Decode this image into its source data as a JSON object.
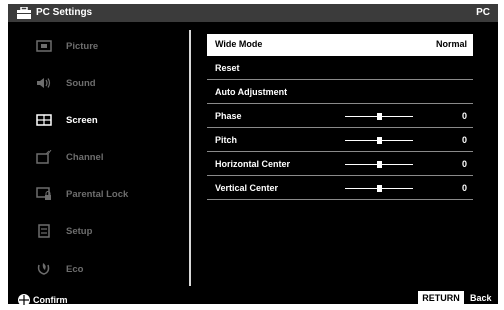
{
  "window": {
    "title": "PC Settings",
    "input_label": "PC"
  },
  "sidebar": {
    "items": [
      {
        "label": "Picture",
        "icon": "picture-icon",
        "active": false
      },
      {
        "label": "Sound",
        "icon": "speaker-icon",
        "active": false
      },
      {
        "label": "Screen",
        "icon": "screen-icon",
        "active": true
      },
      {
        "label": "Channel",
        "icon": "channel-icon",
        "active": false
      },
      {
        "label": "Parental Lock",
        "icon": "parental-lock-icon",
        "active": false
      },
      {
        "label": "Setup",
        "icon": "setup-icon",
        "active": false
      },
      {
        "label": "Eco",
        "icon": "eco-icon",
        "active": false
      }
    ]
  },
  "menu": {
    "rows": [
      {
        "label": "Wide Mode",
        "value": "Normal",
        "selected": true
      },
      {
        "label": "Reset"
      },
      {
        "label": "Auto Adjustment"
      },
      {
        "label": "Phase",
        "value": "0",
        "slider_level": 0.5
      },
      {
        "label": "Pitch",
        "value": "0",
        "slider_level": 0.5
      },
      {
        "label": "Horizontal Center",
        "value": "0",
        "slider_level": 0.5
      },
      {
        "label": "Vertical Center",
        "value": "0",
        "slider_level": 0.5
      }
    ]
  },
  "footer": {
    "confirm_label": "Confirm",
    "return_label": "RETURN",
    "back_label": "Back"
  },
  "colors": {
    "background": "#000000",
    "inactive_text": "#6d6d6d",
    "active_text": "#ffffff",
    "selection": "#ffffff"
  }
}
